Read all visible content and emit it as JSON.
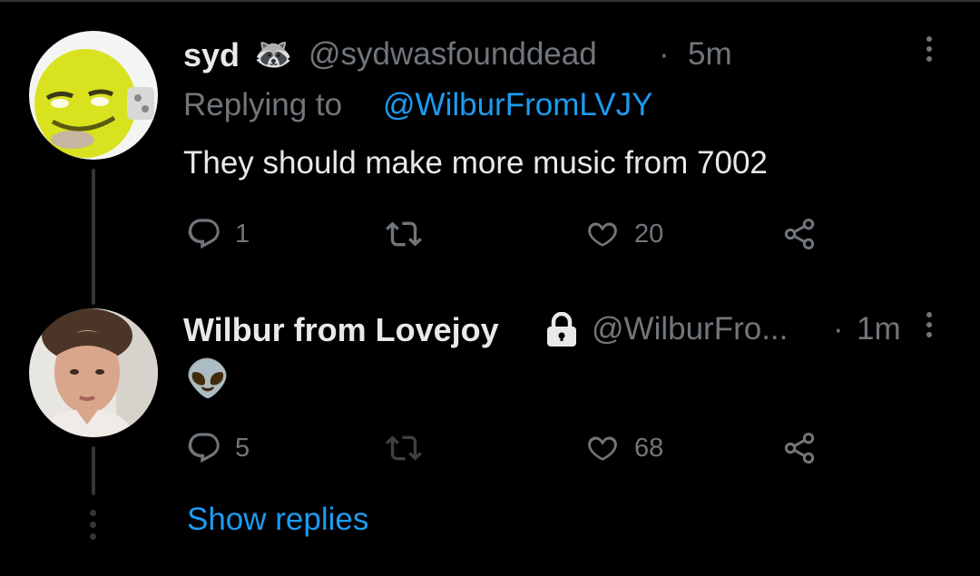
{
  "tweet1": {
    "display_name": "syd",
    "badge_emoji": "🦝",
    "handle": "@sydwasfounddead",
    "separator": "·",
    "time": "5m",
    "replying_prefix": "Replying to",
    "replying_to": "@WilburFromLVJY",
    "text": "They should make more music from 7002",
    "replies": "1",
    "retweets": "",
    "likes": "20"
  },
  "tweet2": {
    "display_name": "Wilbur from Lovejoy",
    "handle": "@WilburFro...",
    "separator": "·",
    "time": "1m",
    "text": "👽",
    "replies": "5",
    "retweets": "",
    "likes": "68"
  },
  "show_replies": "Show replies",
  "colors": {
    "background": "#000000",
    "text": "#e7e9ea",
    "muted": "#71767b",
    "accent": "#1d9bf0",
    "thread_line": "#333639"
  }
}
